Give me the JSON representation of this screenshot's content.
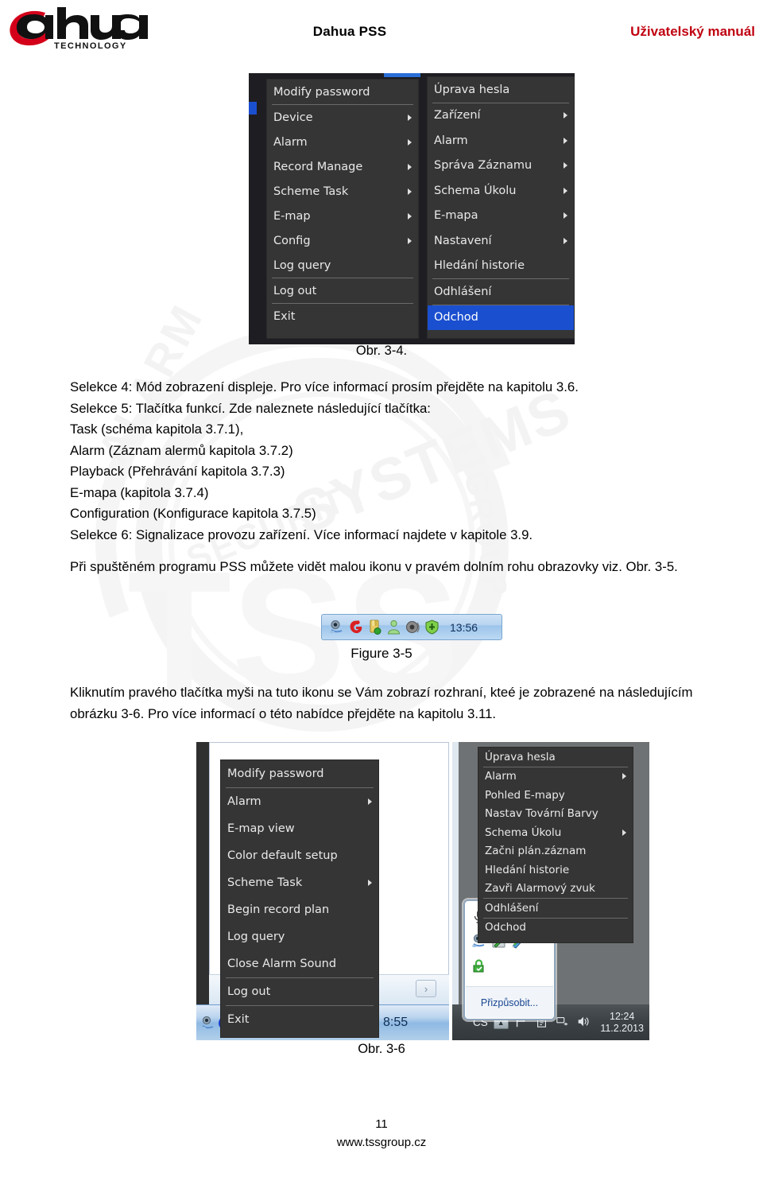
{
  "header": {
    "logo_text": "alhua",
    "logo_sub": "TECHNOLOGY",
    "title": "Dahua PSS",
    "right": "Uživatelský manuál"
  },
  "figure_3_4": {
    "caption": "Obr. 3-4.",
    "menu_en": {
      "items": [
        {
          "label": "Modify password",
          "arrow": false,
          "sep_after": true,
          "selected": false
        },
        {
          "label": "Device",
          "arrow": true,
          "sep_after": false,
          "selected": false
        },
        {
          "label": "Alarm",
          "arrow": true,
          "sep_after": false,
          "selected": false
        },
        {
          "label": "Record Manage",
          "arrow": true,
          "sep_after": false,
          "selected": false
        },
        {
          "label": "Scheme Task",
          "arrow": true,
          "sep_after": false,
          "selected": false
        },
        {
          "label": "E-map",
          "arrow": true,
          "sep_after": false,
          "selected": false
        },
        {
          "label": "Config",
          "arrow": true,
          "sep_after": false,
          "selected": false
        },
        {
          "label": "Log query",
          "arrow": false,
          "sep_after": true,
          "selected": false
        },
        {
          "label": "Log out",
          "arrow": false,
          "sep_after": true,
          "selected": false
        },
        {
          "label": "Exit",
          "arrow": false,
          "sep_after": false,
          "selected": false
        }
      ]
    },
    "menu_cz": {
      "items": [
        {
          "label": "Úprava hesla",
          "arrow": false,
          "sep_after": true,
          "selected": false
        },
        {
          "label": "Zařízení",
          "arrow": true,
          "sep_after": false,
          "selected": false
        },
        {
          "label": "Alarm",
          "arrow": true,
          "sep_after": false,
          "selected": false
        },
        {
          "label": "Správa Záznamu",
          "arrow": true,
          "sep_after": false,
          "selected": false
        },
        {
          "label": "Schema Úkolu",
          "arrow": true,
          "sep_after": false,
          "selected": false
        },
        {
          "label": "E-mapa",
          "arrow": true,
          "sep_after": false,
          "selected": false
        },
        {
          "label": "Nastavení",
          "arrow": true,
          "sep_after": false,
          "selected": false
        },
        {
          "label": "Hledání historie",
          "arrow": false,
          "sep_after": true,
          "selected": false
        },
        {
          "label": "Odhlášení",
          "arrow": false,
          "sep_after": true,
          "selected": false
        },
        {
          "label": "Odchod",
          "arrow": false,
          "sep_after": false,
          "selected": true
        }
      ]
    }
  },
  "paragraphs": {
    "block1": [
      "Selekce 4: Mód zobrazení displeje. Pro více informací prosím přejděte na kapitolu 3.6.",
      "Selekce 5: Tlačítka funkcí. Zde naleznete následující tlačítka:",
      "Task (schéma kapitola 3.7.1),",
      "Alarm (Záznam alermů kapitola 3.7.2)",
      "Playback (Přehrávání kapitola 3.7.3)",
      "E-mapa (kapitola 3.7.4)",
      "Configuration (Konfigurace kapitola 3.7.5)",
      "Selekce 6: Signalizace provozu zařízení. Více informací najdete v kapitole 3.9."
    ],
    "block2": "Při spuštěném programu PSS můžete vidět malou ikonu v pravém dolním rohu obrazovky viz. Obr. 3-5.",
    "block3": "Kliknutím pravého tlačítka myši na tuto ikonu se Vám zobrazí rozhraní, kteé je zobrazené na následujícím obrázku 3-6. Pro více informací o této nabídce přejděte na kapitolu 3.11."
  },
  "figure_3_5": {
    "caption": "Figure 3-5",
    "clock": "13:56",
    "icons": [
      "webcam-icon",
      "red-g-icon",
      "usb-drive-icon",
      "user-icon",
      "speaker-icon",
      "green-shield-icon"
    ]
  },
  "figure_3_6": {
    "caption": "Obr. 3-6",
    "menu_en": {
      "items": [
        {
          "label": "Modify password",
          "arrow": false,
          "sep_after": true,
          "selected": false
        },
        {
          "label": "Alarm",
          "arrow": true,
          "sep_after": false,
          "selected": false
        },
        {
          "label": "E-map view",
          "arrow": false,
          "sep_after": false,
          "selected": false
        },
        {
          "label": "Color default setup",
          "arrow": false,
          "sep_after": false,
          "selected": false
        },
        {
          "label": "Scheme Task",
          "arrow": true,
          "sep_after": false,
          "selected": false
        },
        {
          "label": "Begin record plan",
          "arrow": false,
          "sep_after": false,
          "selected": false
        },
        {
          "label": "Log query",
          "arrow": false,
          "sep_after": false,
          "selected": false
        },
        {
          "label": "Close Alarm Sound",
          "arrow": false,
          "sep_after": true,
          "selected": false
        },
        {
          "label": "Log out",
          "arrow": false,
          "sep_after": true,
          "selected": false
        },
        {
          "label": "Exit",
          "arrow": false,
          "sep_after": false,
          "selected": false
        }
      ]
    },
    "menu_cz": {
      "items": [
        {
          "label": "Úprava hesla",
          "arrow": false,
          "sep_after": true,
          "selected": false
        },
        {
          "label": "Alarm",
          "arrow": true,
          "sep_after": false,
          "selected": false
        },
        {
          "label": "Pohled E-mapy",
          "arrow": false,
          "sep_after": false,
          "selected": false
        },
        {
          "label": "Nastav Tovární Barvy",
          "arrow": false,
          "sep_after": false,
          "selected": false
        },
        {
          "label": "Schema Úkolu",
          "arrow": true,
          "sep_after": false,
          "selected": false
        },
        {
          "label": "Začni plán.záznam",
          "arrow": false,
          "sep_after": false,
          "selected": false
        },
        {
          "label": "Hledání historie",
          "arrow": false,
          "sep_after": false,
          "selected": false
        },
        {
          "label": "Zavři Alarmový zvuk",
          "arrow": false,
          "sep_after": true,
          "selected": false
        },
        {
          "label": "Odhlášení",
          "arrow": false,
          "sep_after": true,
          "selected": false
        },
        {
          "label": "Odchod",
          "arrow": false,
          "sep_after": false,
          "selected": false
        }
      ]
    },
    "left_taskbar": {
      "clock": "8:55",
      "next_button": "›"
    },
    "right_taskbar": {
      "lang": "CS",
      "time": "12:24",
      "date": "11.2.2013"
    },
    "tray_popup": {
      "customize": "Přizpůsobit..."
    }
  },
  "footer": {
    "page_number": "11",
    "site": "www.tssgroup.cz"
  },
  "watermark": {
    "systems": "SYSTEMS",
    "security": "SECURITY",
    "tss": "TSS",
    "group": "GROUP",
    "alarm": "ALARM"
  },
  "colors": {
    "menu_bg": "#353535",
    "menu_selected": "#1a4fcf",
    "header_accent": "#c00010"
  }
}
